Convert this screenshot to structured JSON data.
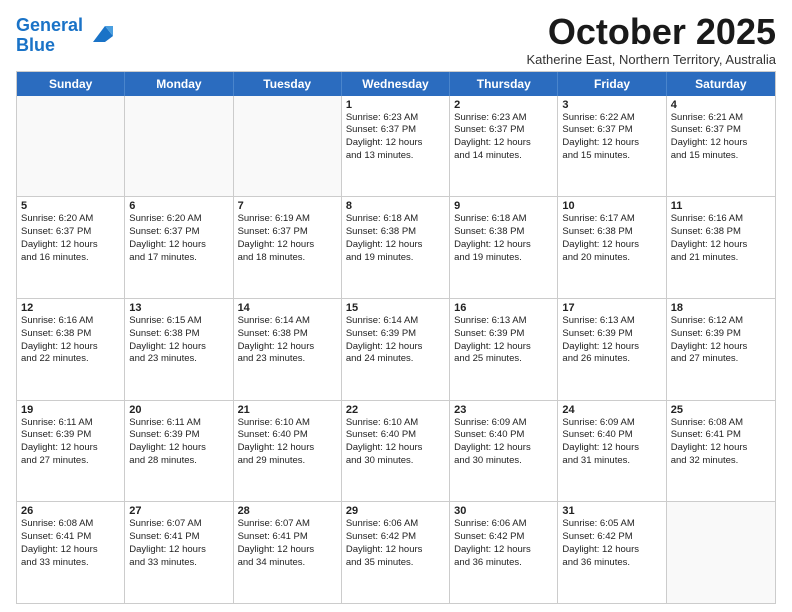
{
  "header": {
    "logo_line1": "General",
    "logo_line2": "Blue",
    "month": "October 2025",
    "location": "Katherine East, Northern Territory, Australia"
  },
  "weekdays": [
    "Sunday",
    "Monday",
    "Tuesday",
    "Wednesday",
    "Thursday",
    "Friday",
    "Saturday"
  ],
  "rows": [
    [
      {
        "day": "",
        "info": [],
        "empty": true
      },
      {
        "day": "",
        "info": [],
        "empty": true
      },
      {
        "day": "",
        "info": [],
        "empty": true
      },
      {
        "day": "1",
        "info": [
          "Sunrise: 6:23 AM",
          "Sunset: 6:37 PM",
          "Daylight: 12 hours",
          "and 13 minutes."
        ]
      },
      {
        "day": "2",
        "info": [
          "Sunrise: 6:23 AM",
          "Sunset: 6:37 PM",
          "Daylight: 12 hours",
          "and 14 minutes."
        ]
      },
      {
        "day": "3",
        "info": [
          "Sunrise: 6:22 AM",
          "Sunset: 6:37 PM",
          "Daylight: 12 hours",
          "and 15 minutes."
        ]
      },
      {
        "day": "4",
        "info": [
          "Sunrise: 6:21 AM",
          "Sunset: 6:37 PM",
          "Daylight: 12 hours",
          "and 15 minutes."
        ]
      }
    ],
    [
      {
        "day": "5",
        "info": [
          "Sunrise: 6:20 AM",
          "Sunset: 6:37 PM",
          "Daylight: 12 hours",
          "and 16 minutes."
        ]
      },
      {
        "day": "6",
        "info": [
          "Sunrise: 6:20 AM",
          "Sunset: 6:37 PM",
          "Daylight: 12 hours",
          "and 17 minutes."
        ]
      },
      {
        "day": "7",
        "info": [
          "Sunrise: 6:19 AM",
          "Sunset: 6:37 PM",
          "Daylight: 12 hours",
          "and 18 minutes."
        ]
      },
      {
        "day": "8",
        "info": [
          "Sunrise: 6:18 AM",
          "Sunset: 6:38 PM",
          "Daylight: 12 hours",
          "and 19 minutes."
        ]
      },
      {
        "day": "9",
        "info": [
          "Sunrise: 6:18 AM",
          "Sunset: 6:38 PM",
          "Daylight: 12 hours",
          "and 19 minutes."
        ]
      },
      {
        "day": "10",
        "info": [
          "Sunrise: 6:17 AM",
          "Sunset: 6:38 PM",
          "Daylight: 12 hours",
          "and 20 minutes."
        ]
      },
      {
        "day": "11",
        "info": [
          "Sunrise: 6:16 AM",
          "Sunset: 6:38 PM",
          "Daylight: 12 hours",
          "and 21 minutes."
        ]
      }
    ],
    [
      {
        "day": "12",
        "info": [
          "Sunrise: 6:16 AM",
          "Sunset: 6:38 PM",
          "Daylight: 12 hours",
          "and 22 minutes."
        ]
      },
      {
        "day": "13",
        "info": [
          "Sunrise: 6:15 AM",
          "Sunset: 6:38 PM",
          "Daylight: 12 hours",
          "and 23 minutes."
        ]
      },
      {
        "day": "14",
        "info": [
          "Sunrise: 6:14 AM",
          "Sunset: 6:38 PM",
          "Daylight: 12 hours",
          "and 23 minutes."
        ]
      },
      {
        "day": "15",
        "info": [
          "Sunrise: 6:14 AM",
          "Sunset: 6:39 PM",
          "Daylight: 12 hours",
          "and 24 minutes."
        ]
      },
      {
        "day": "16",
        "info": [
          "Sunrise: 6:13 AM",
          "Sunset: 6:39 PM",
          "Daylight: 12 hours",
          "and 25 minutes."
        ]
      },
      {
        "day": "17",
        "info": [
          "Sunrise: 6:13 AM",
          "Sunset: 6:39 PM",
          "Daylight: 12 hours",
          "and 26 minutes."
        ]
      },
      {
        "day": "18",
        "info": [
          "Sunrise: 6:12 AM",
          "Sunset: 6:39 PM",
          "Daylight: 12 hours",
          "and 27 minutes."
        ]
      }
    ],
    [
      {
        "day": "19",
        "info": [
          "Sunrise: 6:11 AM",
          "Sunset: 6:39 PM",
          "Daylight: 12 hours",
          "and 27 minutes."
        ]
      },
      {
        "day": "20",
        "info": [
          "Sunrise: 6:11 AM",
          "Sunset: 6:39 PM",
          "Daylight: 12 hours",
          "and 28 minutes."
        ]
      },
      {
        "day": "21",
        "info": [
          "Sunrise: 6:10 AM",
          "Sunset: 6:40 PM",
          "Daylight: 12 hours",
          "and 29 minutes."
        ]
      },
      {
        "day": "22",
        "info": [
          "Sunrise: 6:10 AM",
          "Sunset: 6:40 PM",
          "Daylight: 12 hours",
          "and 30 minutes."
        ]
      },
      {
        "day": "23",
        "info": [
          "Sunrise: 6:09 AM",
          "Sunset: 6:40 PM",
          "Daylight: 12 hours",
          "and 30 minutes."
        ]
      },
      {
        "day": "24",
        "info": [
          "Sunrise: 6:09 AM",
          "Sunset: 6:40 PM",
          "Daylight: 12 hours",
          "and 31 minutes."
        ]
      },
      {
        "day": "25",
        "info": [
          "Sunrise: 6:08 AM",
          "Sunset: 6:41 PM",
          "Daylight: 12 hours",
          "and 32 minutes."
        ]
      }
    ],
    [
      {
        "day": "26",
        "info": [
          "Sunrise: 6:08 AM",
          "Sunset: 6:41 PM",
          "Daylight: 12 hours",
          "and 33 minutes."
        ]
      },
      {
        "day": "27",
        "info": [
          "Sunrise: 6:07 AM",
          "Sunset: 6:41 PM",
          "Daylight: 12 hours",
          "and 33 minutes."
        ]
      },
      {
        "day": "28",
        "info": [
          "Sunrise: 6:07 AM",
          "Sunset: 6:41 PM",
          "Daylight: 12 hours",
          "and 34 minutes."
        ]
      },
      {
        "day": "29",
        "info": [
          "Sunrise: 6:06 AM",
          "Sunset: 6:42 PM",
          "Daylight: 12 hours",
          "and 35 minutes."
        ]
      },
      {
        "day": "30",
        "info": [
          "Sunrise: 6:06 AM",
          "Sunset: 6:42 PM",
          "Daylight: 12 hours",
          "and 36 minutes."
        ]
      },
      {
        "day": "31",
        "info": [
          "Sunrise: 6:05 AM",
          "Sunset: 6:42 PM",
          "Daylight: 12 hours",
          "and 36 minutes."
        ]
      },
      {
        "day": "",
        "info": [],
        "empty": true
      }
    ]
  ]
}
